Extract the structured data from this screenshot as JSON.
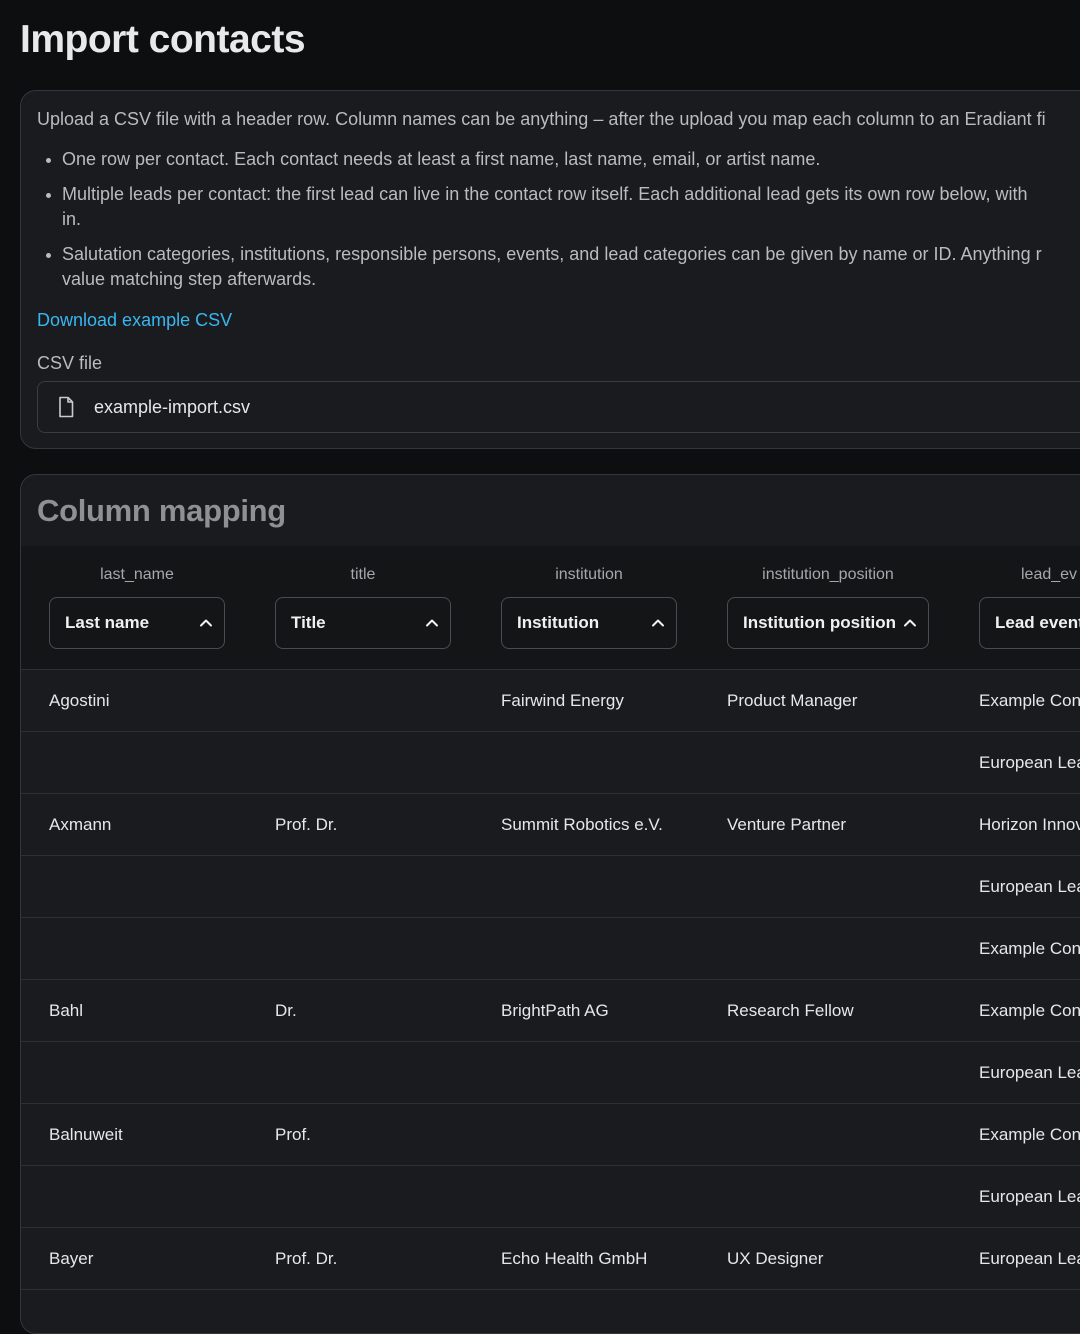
{
  "page": {
    "title": "Import contacts"
  },
  "upload": {
    "intro": "Upload a CSV file with a header row. Column names can be anything – after the upload you map each column to an Eradiant fi",
    "bullets": [
      "One row per contact. Each contact needs at least a first name, last name, email, or artist name.",
      "Multiple leads per contact: the first lead can live in the contact row itself. Each additional lead gets its own row below, with\nin.",
      "Salutation categories, institutions, responsible persons, events, and lead categories can be given by name or ID. Anything r\nvalue matching step afterwards."
    ],
    "download_label": "Download example CSV",
    "file_label": "CSV file",
    "file_name": "example-import.csv",
    "file_icon": "file-icon"
  },
  "mapping": {
    "title": "Column mapping",
    "columns": [
      {
        "key": "last_name",
        "selected": "Last name"
      },
      {
        "key": "title",
        "selected": "Title"
      },
      {
        "key": "institution",
        "selected": "Institution"
      },
      {
        "key": "institution_position",
        "selected": "Institution position"
      },
      {
        "key": "lead_ev",
        "selected": "Lead event"
      }
    ],
    "rows": [
      [
        "Agostini",
        "",
        "Fairwind Energy",
        "Product Manager",
        "Example Con"
      ],
      [
        "",
        "",
        "",
        "",
        "European Lea"
      ],
      [
        "Axmann",
        "Prof. Dr.",
        "Summit Robotics e.V.",
        "Venture Partner",
        "Horizon Innov"
      ],
      [
        "",
        "",
        "",
        "",
        "European Lea"
      ],
      [
        "",
        "",
        "",
        "",
        "Example Con"
      ],
      [
        "Bahl",
        "Dr.",
        "BrightPath AG",
        "Research Fellow",
        "Example Con"
      ],
      [
        "",
        "",
        "",
        "",
        "European Lea"
      ],
      [
        "Balnuweit",
        "Prof.",
        "",
        "",
        "Example Con"
      ],
      [
        "",
        "",
        "",
        "",
        "European Lea"
      ],
      [
        "Bayer",
        "Prof. Dr.",
        "Echo Health GmbH",
        "UX Designer",
        "European Lea"
      ]
    ]
  },
  "colors": {
    "link": "#38b6f0",
    "background": "#0d0e10",
    "card": "#1a1b1e"
  }
}
